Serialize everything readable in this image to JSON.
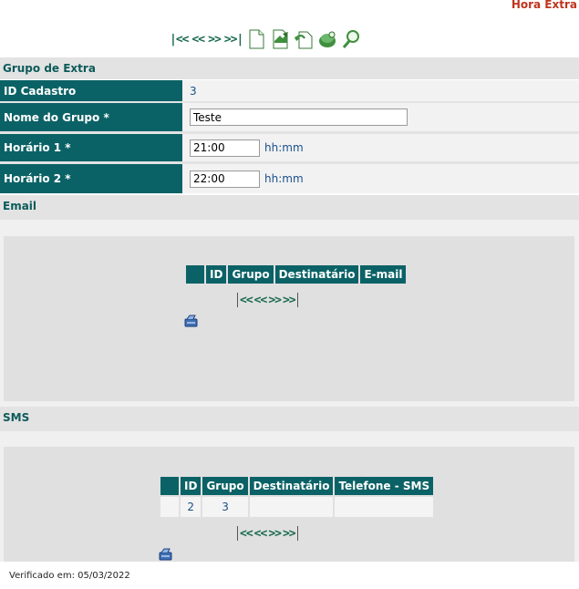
{
  "page": {
    "title": "Hora Extra"
  },
  "toolbar": {
    "nav": {
      "first": "|<<",
      "prev": "<<",
      "next": ">>",
      "last": ">>|"
    },
    "icons": [
      "new-document-icon",
      "save-document-icon",
      "undo-document-icon",
      "delete-icon",
      "search-icon"
    ]
  },
  "form": {
    "section_title": "Grupo de Extra",
    "fields": {
      "id": {
        "label": "ID Cadastro",
        "value": "3"
      },
      "nome": {
        "label": "Nome do Grupo *",
        "value": "Teste"
      },
      "h1": {
        "label": "Horário 1 *",
        "value": "21:00",
        "hint": "hh:mm"
      },
      "h2": {
        "label": "Horário 2 *",
        "value": "22:00",
        "hint": "hh:mm"
      }
    }
  },
  "email": {
    "section_title": "Email",
    "columns": [
      "",
      "ID",
      "Grupo",
      "Destinatário",
      "E-mail"
    ],
    "pager": {
      "first": "<<",
      "prev": "<<",
      "next": ">>",
      "last": ">>"
    }
  },
  "sms": {
    "section_title": "SMS",
    "columns": [
      "",
      "ID",
      "Grupo",
      "Destinatário",
      "Telefone - SMS"
    ],
    "rows": [
      {
        "sel": "",
        "id": "2",
        "grupo": "3",
        "dest": "",
        "tel": ""
      }
    ],
    "pager": {
      "first": "<<",
      "prev": "<<",
      "next": ">>",
      "last": ">>"
    }
  },
  "footer": {
    "verified": "Verificado em: 05/03/2022"
  },
  "colors": {
    "header_bg": "#0b6266",
    "title_red": "#c0341d",
    "link_blue": "#1a4f8a"
  }
}
